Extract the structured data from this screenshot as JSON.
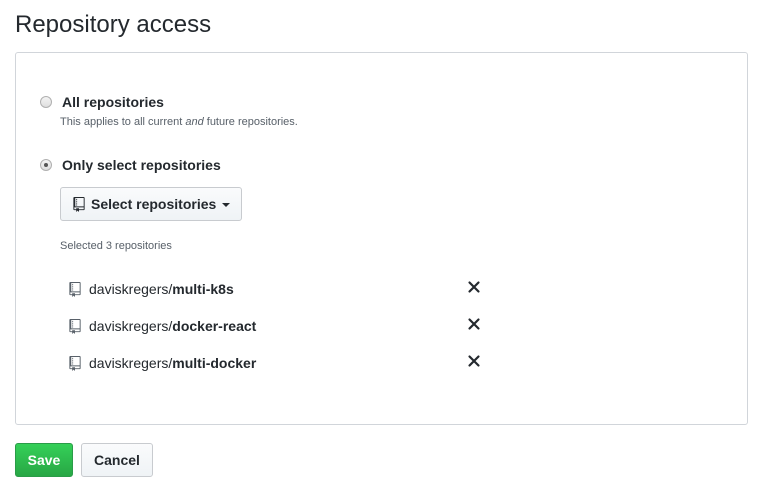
{
  "page": {
    "title": "Repository access"
  },
  "access": {
    "all": {
      "label": "All repositories",
      "note_before": "This applies to all current ",
      "note_em": "and",
      "note_after": " future repositories.",
      "checked": false
    },
    "select": {
      "label": "Only select repositories",
      "checked": true
    },
    "select_button_label": "Select repositories",
    "selected_count_text": "Selected 3 repositories",
    "repositories": [
      {
        "owner": "daviskregers/",
        "name": "multi-k8s"
      },
      {
        "owner": "daviskregers/",
        "name": "docker-react"
      },
      {
        "owner": "daviskregers/",
        "name": "multi-docker"
      }
    ]
  },
  "actions": {
    "save_label": "Save",
    "cancel_label": "Cancel"
  },
  "colors": {
    "save_green": "#2ea44f",
    "text": "#24292e",
    "muted": "#586069",
    "border": "#d1d5da"
  },
  "icons": {
    "repo": "repo-icon",
    "remove": "close-icon",
    "caret": "caret-down-icon"
  }
}
